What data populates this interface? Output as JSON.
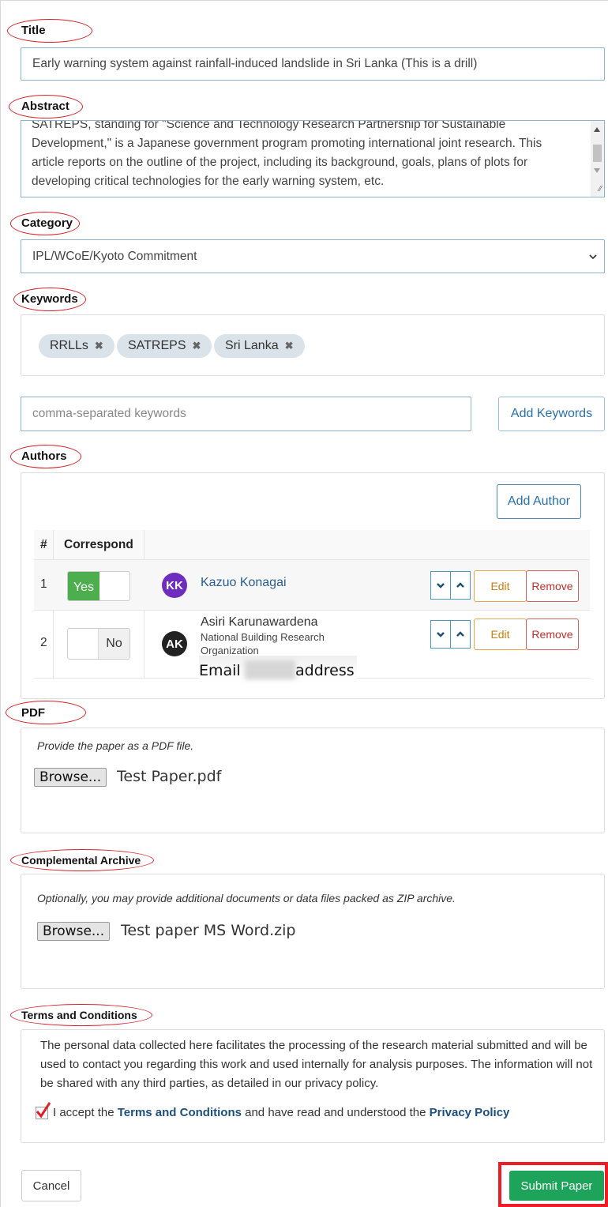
{
  "labels": {
    "title": "Title",
    "abstract": "Abstract",
    "category": "Category",
    "keywords": "Keywords",
    "authors": "Authors",
    "pdf": "PDF",
    "archive": "Complemental Archive",
    "terms": "Terms and Conditions"
  },
  "title_value": "Early warning system against rainfall-induced landslide in Sri Lanka (This is a drill)",
  "abstract_lines": [
    "SATREPS, standing for \"Science and Technology Research Partnership for Sustainable",
    "Development,\" is a Japanese government program promoting international joint research. This",
    "article reports on the outline of the project, including its background, goals, plans of plots for",
    "developing critical technologies for the early warning system, etc."
  ],
  "category_value": "IPL/WCoE/Kyoto Commitment",
  "keywords": [
    {
      "label": "RRLLs",
      "remove": "✖"
    },
    {
      "label": "SATREPS",
      "remove": "✖"
    },
    {
      "label": "Sri Lanka",
      "remove": "✖"
    }
  ],
  "keyword_input_placeholder": "comma-separated keywords",
  "add_keywords_label": "Add Keywords",
  "add_author_label": "Add Author",
  "table": {
    "col_num": "#",
    "col_correspond": "Correspond"
  },
  "authors": [
    {
      "num": "1",
      "toggle": "Yes",
      "initials": "KK",
      "avatar_color": "#6f2dbd",
      "name": "Kazuo Konagai",
      "aff": ""
    },
    {
      "num": "2",
      "toggle": "No",
      "initials": "AK",
      "avatar_color": "#222222",
      "name": "Asiri Karunawardena",
      "aff_1": "National Building Research",
      "aff_2": "Organization"
    }
  ],
  "edit_label": "Edit",
  "remove_label": "Remove",
  "email_overlay": {
    "word1": "Email",
    "word2": "address"
  },
  "pdf_hint": "Provide the paper as a PDF file.",
  "pdf_browse": "Browse...",
  "pdf_file": "Test Paper.pdf",
  "archive_hint": "Optionally, you may provide additional documents or data files packed as ZIP archive.",
  "archive_browse": "Browse...",
  "archive_file": "Test paper MS Word.zip",
  "terms_text": "The personal data collected here facilitates the processing of the research material submitted and will be used to contact you regarding this work and used internally for analysis purposes. The information will not be shared with any third parties, as detailed in our privacy policy.",
  "accept": {
    "prefix": "I accept the ",
    "terms_link": "Terms and Conditions",
    "middle": " and have read and understood the ",
    "privacy_link": "Privacy Policy"
  },
  "cancel_label": "Cancel",
  "submit_label": "Submit Paper",
  "colors": {
    "annotation_red": "#d2232a",
    "submit_green": "#1ea35a",
    "toggle_green": "#4cae4c"
  }
}
